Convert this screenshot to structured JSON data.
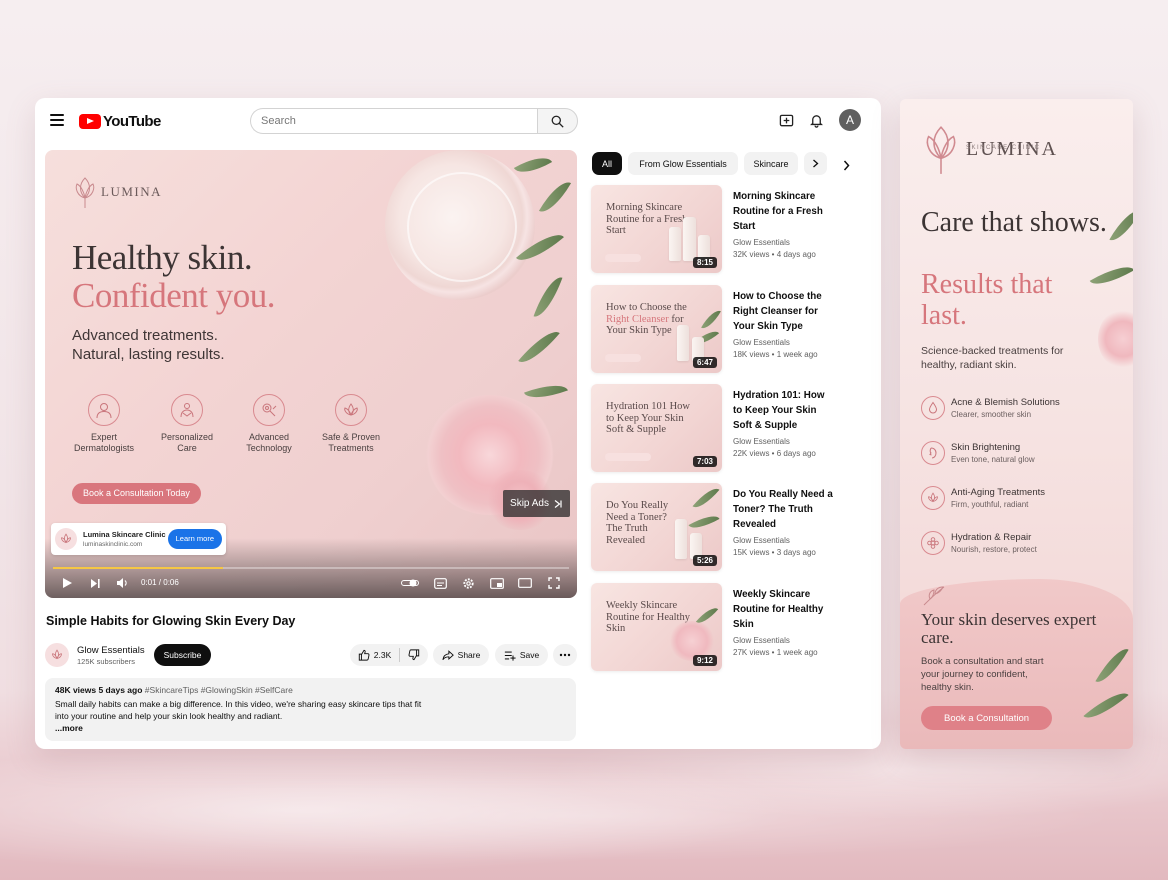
{
  "header": {
    "logo_text": "YouTube",
    "search_placeholder": "Search",
    "avatar_initial": "A"
  },
  "player": {
    "ad_brand": "LUMINA",
    "headline_line1": "Healthy skin.",
    "headline_line2": "Confident you.",
    "tagline_line1": "Advanced treatments.",
    "tagline_line2": "Natural, lasting results.",
    "features": [
      {
        "line1": "Expert",
        "line2": "Dermatologists",
        "icon": "doctor-icon"
      },
      {
        "line1": "Personalized",
        "line2": "Care",
        "icon": "hands-icon"
      },
      {
        "line1": "Advanced",
        "line2": "Technology",
        "icon": "device-icon"
      },
      {
        "line1": "Safe & Proven",
        "line2": "Treatments",
        "icon": "lotus-icon"
      }
    ],
    "cta_label": "Book a Consultation Today",
    "skip_label": "Skip Ads",
    "ad_card": {
      "name": "Lumina Skincare Clinic",
      "url": "luminaskinclinic.com",
      "learn_label": "Learn more"
    },
    "time_label": "0:01 / 0:06",
    "progress": 0.33
  },
  "video": {
    "title": "Simple Habits for Glowing Skin Every Day",
    "channel": "Glow Essentials",
    "subscribers": "125K subscribers",
    "subscribe_label": "Subscribe",
    "likes": "2.3K",
    "share_label": "Share",
    "save_label": "Save",
    "views_date": "48K views  5 days ago",
    "hashtags": "#SkincareTips #GlowingSkin #SelfCare",
    "description": "Small daily habits can make a big difference. In this video, we're sharing easy skincare tips that fit into your routine and help your skin look healthy and radiant.",
    "more_label": "...more"
  },
  "chips": [
    "All",
    "From Glow Essentials",
    "Skincare"
  ],
  "recommendations": [
    {
      "thumb_text": "Morning Skincare Routine for a Fresh Start",
      "title": "Morning Skincare Routine for a Fresh Start",
      "channel": "Glow Essentials",
      "meta": "32K views • 4 days ago",
      "duration": "8:15"
    },
    {
      "thumb_pre": "How to Choose the ",
      "thumb_accent": "Right Cleanser",
      "thumb_post": " for Your Skin Type",
      "title": "How to Choose the Right Cleanser for Your Skin Type",
      "channel": "Glow Essentials",
      "meta": "18K views • 1 week ago",
      "duration": "6:47"
    },
    {
      "thumb_text": "Hydration 101 How to Keep Your Skin Soft & Supple",
      "title": "Hydration 101: How to Keep Your Skin Soft & Supple",
      "channel": "Glow Essentials",
      "meta": "22K views • 6 days ago",
      "duration": "7:03"
    },
    {
      "thumb_text": "Do You Really Need a Toner? The Truth Revealed",
      "title": "Do You Really Need a Toner? The Truth Revealed",
      "channel": "Glow Essentials",
      "meta": "15K views • 3 days ago",
      "duration": "5:26"
    },
    {
      "thumb_text": "Weekly Skincare Routine for Healthy Skin",
      "title": "Weekly Skincare Routine for Healthy Skin",
      "channel": "Glow Essentials",
      "meta": "27K views • 1 week ago",
      "duration": "9:12"
    }
  ],
  "banner": {
    "brand": "LUMINA",
    "brand_sub": "SKINCARE CLINIC",
    "headline1": "Care that shows.",
    "headline2": "Results that last.",
    "body": "Science-backed treatments for healthy, radiant skin.",
    "features": [
      {
        "title": "Acne & Blemish Solutions",
        "sub": "Clearer, smoother skin"
      },
      {
        "title": "Skin Brightening",
        "sub": "Even tone, natural glow"
      },
      {
        "title": "Anti-Aging Treatments",
        "sub": "Firm, youthful, radiant"
      },
      {
        "title": "Hydration & Repair",
        "sub": "Nourish, restore, protect"
      }
    ],
    "closing_headline": "Your skin deserves expert care.",
    "closing_body": "Book a consultation and start your journey to confident, healthy skin.",
    "cta_label": "Book a Consultation"
  },
  "colors": {
    "accent_rose": "#d6767c",
    "youtube_red": "#ff0000",
    "learn_blue": "#1a73e8"
  }
}
